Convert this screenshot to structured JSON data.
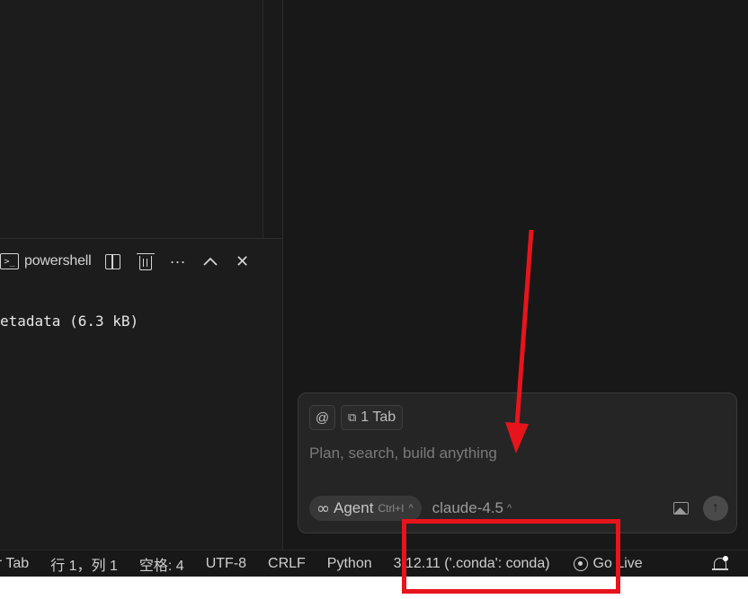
{
  "terminal": {
    "tab_label": "powershell",
    "output_line": "etadata (6.3 kB)",
    "icons": {
      "terminal": "terminal-prompt-icon",
      "split": "split-terminal-icon",
      "trash": "trash-icon",
      "more": "ellipsis-icon",
      "maximize": "chevron-up-icon",
      "close": "close-icon"
    },
    "more_glyph": "···",
    "max_glyph": "⌃",
    "close_glyph": "✕"
  },
  "chat": {
    "at_label": "@",
    "context_chip": "1 Tab",
    "placeholder": "Plan, search, build anything",
    "agent_label": "Agent",
    "agent_shortcut": "Ctrl+I",
    "agent_caret": "^",
    "model_label": "claude-4.5",
    "model_caret": "^",
    "send_glyph": "↑",
    "icons": {
      "context": "clipboard-icon",
      "agent": "infinity-icon",
      "image": "image-icon",
      "send": "arrow-up-icon"
    }
  },
  "statusbar": {
    "items": [
      "or Tab",
      "行 1，列 1",
      "空格: 4",
      "UTF-8",
      "CRLF",
      "Python",
      "3.12.11 ('.conda': conda)",
      "Go Live"
    ],
    "icons": {
      "go_live": "broadcast-icon",
      "notifications": "bell-icon"
    }
  },
  "annotation": {
    "color": "#e8141c"
  }
}
